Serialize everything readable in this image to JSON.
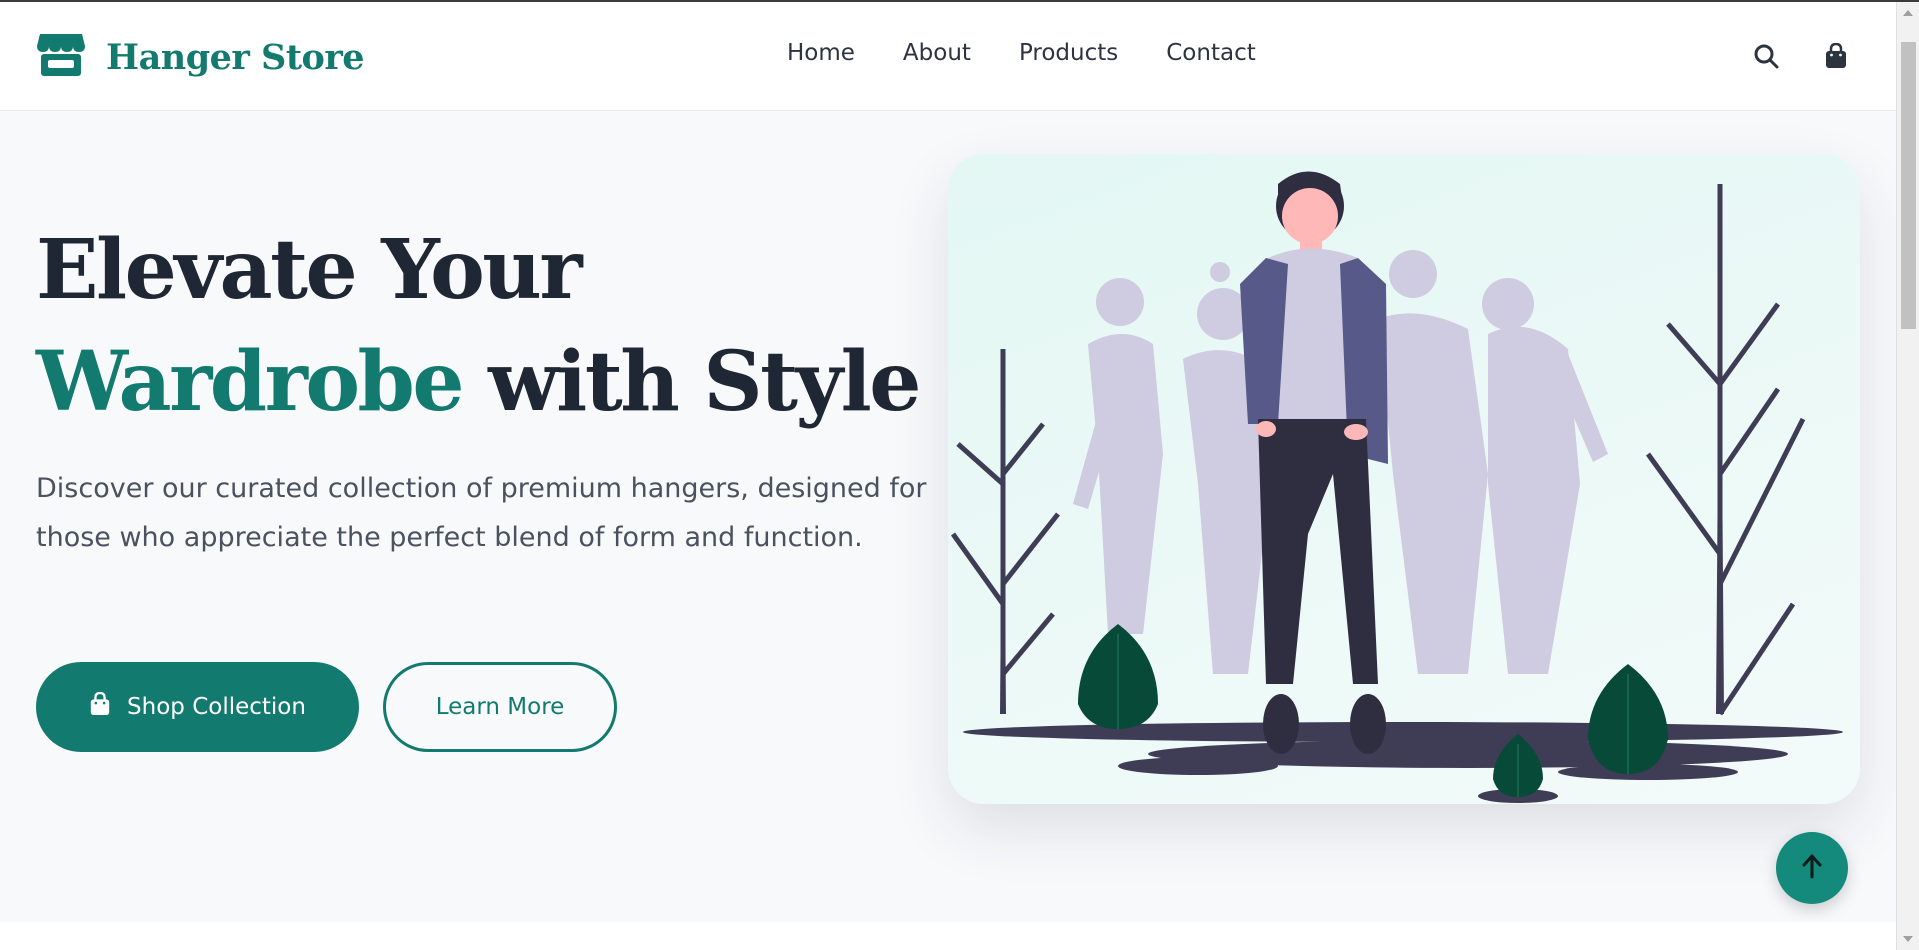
{
  "brand": {
    "name": "Hanger Store",
    "color": "#127a6e",
    "icon": "store-icon"
  },
  "nav": {
    "items": [
      {
        "label": "Home"
      },
      {
        "label": "About"
      },
      {
        "label": "Products"
      },
      {
        "label": "Contact"
      }
    ]
  },
  "header_icons": {
    "search": "search-icon",
    "cart": "shopping-bag-icon"
  },
  "hero": {
    "title_line1": "Elevate Your",
    "title_accent": "Wardrobe",
    "title_rest": " with Style",
    "subtitle": "Discover our curated collection of premium hangers, designed for those who appreciate the perfect blend of form and function.",
    "primary_button": "Shop Collection",
    "secondary_button": "Learn More",
    "illustration": "people-fashion-illustration"
  },
  "scroll_top": {
    "icon": "arrow-up-icon"
  },
  "colors": {
    "accent": "#127a6e",
    "text_dark": "#1f2634",
    "text_muted": "#4a5260",
    "background": "#f8f9fb"
  }
}
